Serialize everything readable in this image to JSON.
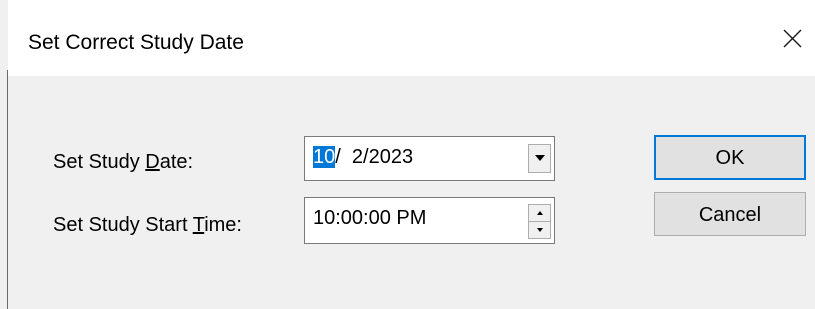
{
  "window": {
    "title": "Set Correct Study Date",
    "close_icon": "close-icon"
  },
  "date_row": {
    "label_before": "Set Study ",
    "label_accel": "D",
    "label_after": "ate:",
    "month": "10",
    "rest": "/  2/2023",
    "selected_segment": "month",
    "dropdown_icon": "chevron-down-icon"
  },
  "time_row": {
    "label_before": "Set Study Start ",
    "label_accel": "T",
    "label_after": "ime:",
    "value": "10:00:00 PM",
    "spin_up_icon": "spin-up-icon",
    "spin_down_icon": "spin-down-icon"
  },
  "buttons": {
    "ok_label": "OK",
    "cancel_label": "Cancel"
  },
  "colors": {
    "selection": "#0078d7",
    "dialog_bg": "#f0f0f0",
    "title_bg": "#ffffff",
    "button_bg": "#e1e1e1"
  }
}
